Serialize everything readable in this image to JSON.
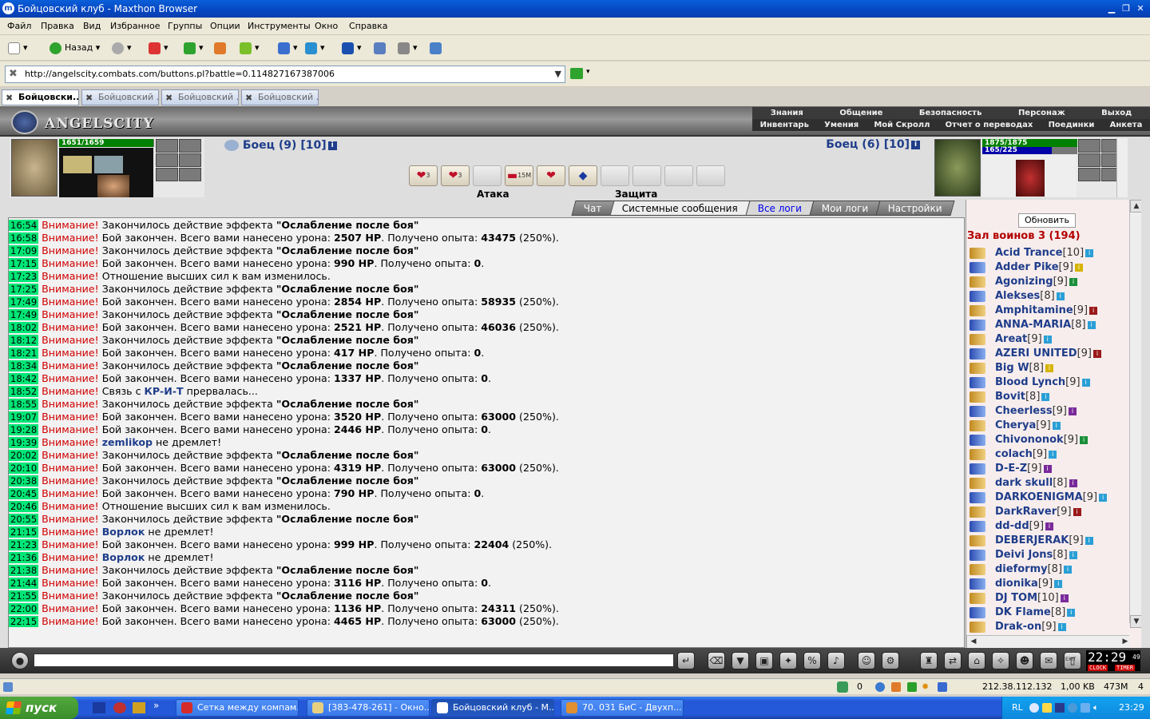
{
  "window": {
    "title": "Бойцовский клуб - Maxthon Browser"
  },
  "menu": [
    "Файл",
    "Правка",
    "Вид",
    "Избранное",
    "Группы",
    "Опции",
    "Инструменты",
    "Окно",
    "Справка"
  ],
  "toolbar": {
    "back_label": "Назад"
  },
  "address": {
    "url": "http://angelscity.combats.com/buttons.pl?battle=0.114827167387006"
  },
  "tabs": [
    {
      "label": "Бойцовски...",
      "active": true
    },
    {
      "label": "Бойцовский ...",
      "active": false
    },
    {
      "label": "Бойцовский ...",
      "active": false
    },
    {
      "label": "Бойцовский ...",
      "active": false
    }
  ],
  "game": {
    "logo": "ANGELSCITY",
    "menu_top": [
      "Знания",
      "Общение",
      "Безопасность",
      "Персонаж",
      "Выход"
    ],
    "menu_bottom": [
      "Инвентарь",
      "Умения",
      "Мой Скролл",
      "Отчет о переводах",
      "Поединки",
      "Анкета"
    ],
    "left_fighter": {
      "hp": "1651/1659",
      "hp_fraction": 0.995,
      "name": "Боец (9) [10]"
    },
    "right_fighter": {
      "hp": "1875/1875",
      "hp_fraction": 1.0,
      "mp": "165/225",
      "mp_fraction": 0.733,
      "name": "Боец (6) [10]"
    },
    "scrolls": [
      {
        "icon": "heart-icon",
        "empty": false,
        "badge": "3"
      },
      {
        "icon": "heart-icon",
        "empty": false,
        "badge": "3"
      },
      {
        "icon": "",
        "empty": true,
        "badge": ""
      },
      {
        "icon": "hat-icon",
        "empty": false,
        "badge": "15M"
      },
      {
        "icon": "heart-icon",
        "empty": false,
        "badge": ""
      },
      {
        "icon": "diamond-icon",
        "empty": false,
        "badge": ""
      },
      {
        "icon": "",
        "empty": true,
        "badge": ""
      },
      {
        "icon": "",
        "empty": true,
        "badge": ""
      },
      {
        "icon": "",
        "empty": true,
        "badge": ""
      },
      {
        "icon": "",
        "empty": true,
        "badge": ""
      }
    ],
    "attack_label": "Атака",
    "defense_label": "Защита",
    "chat_tabs": [
      {
        "label": "Чат",
        "style": "normal"
      },
      {
        "label": "Системные сообщения",
        "style": "sel"
      },
      {
        "label": "Все логи",
        "style": "hl"
      },
      {
        "label": "Мои логи",
        "style": "normal"
      },
      {
        "label": "Настройки",
        "style": "normal"
      }
    ],
    "warn_word": "Внимание!",
    "log": [
      {
        "t": "16:54",
        "p": [
          [
            "Закончилось действие эффекта ",
            ""
          ],
          [
            "\"Ослабление после боя\"",
            "b"
          ]
        ]
      },
      {
        "t": "16:58",
        "p": [
          [
            "Бой закончен. Всего вами нанесено урона: ",
            ""
          ],
          [
            "2507 HP",
            "b"
          ],
          [
            ". Получено опыта: ",
            ""
          ],
          [
            "43475",
            "b"
          ],
          [
            " (250%).",
            ""
          ]
        ]
      },
      {
        "t": "17:09",
        "p": [
          [
            "Закончилось действие эффекта ",
            ""
          ],
          [
            "\"Ослабление после боя\"",
            "b"
          ]
        ]
      },
      {
        "t": "17:15",
        "p": [
          [
            "Бой закончен. Всего вами нанесено урона: ",
            ""
          ],
          [
            "990 HP",
            "b"
          ],
          [
            ". Получено опыта: ",
            ""
          ],
          [
            "0",
            "b"
          ],
          [
            ".",
            ""
          ]
        ]
      },
      {
        "t": "17:23",
        "p": [
          [
            "Отношение высших сил к вам изменилось.",
            ""
          ]
        ]
      },
      {
        "t": "17:25",
        "p": [
          [
            "Закончилось действие эффекта ",
            ""
          ],
          [
            "\"Ослабление после боя\"",
            "b"
          ]
        ]
      },
      {
        "t": "17:49",
        "p": [
          [
            "Бой закончен. Всего вами нанесено урона: ",
            ""
          ],
          [
            "2854 HP",
            "b"
          ],
          [
            ". Получено опыта: ",
            ""
          ],
          [
            "58935",
            "b"
          ],
          [
            " (250%).",
            ""
          ]
        ]
      },
      {
        "t": "17:49",
        "p": [
          [
            "Закончилось действие эффекта ",
            ""
          ],
          [
            "\"Ослабление после боя\"",
            "b"
          ]
        ]
      },
      {
        "t": "18:02",
        "p": [
          [
            "Бой закончен. Всего вами нанесено урона: ",
            ""
          ],
          [
            "2521 HP",
            "b"
          ],
          [
            ". Получено опыта: ",
            ""
          ],
          [
            "46036",
            "b"
          ],
          [
            " (250%).",
            ""
          ]
        ]
      },
      {
        "t": "18:12",
        "p": [
          [
            "Закончилось действие эффекта ",
            ""
          ],
          [
            "\"Ослабление после боя\"",
            "b"
          ]
        ]
      },
      {
        "t": "18:21",
        "p": [
          [
            "Бой закончен. Всего вами нанесено урона: ",
            ""
          ],
          [
            "417 HP",
            "b"
          ],
          [
            ". Получено опыта: ",
            ""
          ],
          [
            "0",
            "b"
          ],
          [
            ".",
            ""
          ]
        ]
      },
      {
        "t": "18:34",
        "p": [
          [
            "Закончилось действие эффекта ",
            ""
          ],
          [
            "\"Ослабление после боя\"",
            "b"
          ]
        ]
      },
      {
        "t": "18:42",
        "p": [
          [
            "Бой закончен. Всего вами нанесено урона: ",
            ""
          ],
          [
            "1337 HP",
            "b"
          ],
          [
            ". Получено опыта: ",
            ""
          ],
          [
            "0",
            "b"
          ],
          [
            ".",
            ""
          ]
        ]
      },
      {
        "t": "18:52",
        "p": [
          [
            "Связь с ",
            ""
          ],
          [
            "КР-И-Т",
            "n"
          ],
          [
            " прервалась...",
            ""
          ]
        ]
      },
      {
        "t": "18:55",
        "p": [
          [
            "Закончилось действие эффекта ",
            ""
          ],
          [
            "\"Ослабление после боя\"",
            "b"
          ]
        ]
      },
      {
        "t": "19:07",
        "p": [
          [
            "Бой закончен. Всего вами нанесено урона: ",
            ""
          ],
          [
            "3520 HP",
            "b"
          ],
          [
            ". Получено опыта: ",
            ""
          ],
          [
            "63000",
            "b"
          ],
          [
            " (250%).",
            ""
          ]
        ]
      },
      {
        "t": "19:28",
        "p": [
          [
            "Бой закончен. Всего вами нанесено урона: ",
            ""
          ],
          [
            "2446 HP",
            "b"
          ],
          [
            ". Получено опыта: ",
            ""
          ],
          [
            "0",
            "b"
          ],
          [
            ".",
            ""
          ]
        ]
      },
      {
        "t": "19:39",
        "p": [
          [
            "zemlikop",
            "n"
          ],
          [
            " не дремлет!",
            ""
          ]
        ]
      },
      {
        "t": "20:02",
        "p": [
          [
            "Закончилось действие эффекта ",
            ""
          ],
          [
            "\"Ослабление после боя\"",
            "b"
          ]
        ]
      },
      {
        "t": "20:10",
        "p": [
          [
            "Бой закончен. Всего вами нанесено урона: ",
            ""
          ],
          [
            "4319 HP",
            "b"
          ],
          [
            ". Получено опыта: ",
            ""
          ],
          [
            "63000",
            "b"
          ],
          [
            " (250%).",
            ""
          ]
        ]
      },
      {
        "t": "20:38",
        "p": [
          [
            "Закончилось действие эффекта ",
            ""
          ],
          [
            "\"Ослабление после боя\"",
            "b"
          ]
        ]
      },
      {
        "t": "20:45",
        "p": [
          [
            "Бой закончен. Всего вами нанесено урона: ",
            ""
          ],
          [
            "790 HP",
            "b"
          ],
          [
            ". Получено опыта: ",
            ""
          ],
          [
            "0",
            "b"
          ],
          [
            ".",
            ""
          ]
        ]
      },
      {
        "t": "20:46",
        "p": [
          [
            "Отношение высших сил к вам изменилось.",
            ""
          ]
        ]
      },
      {
        "t": "20:55",
        "p": [
          [
            "Закончилось действие эффекта ",
            ""
          ],
          [
            "\"Ослабление после боя\"",
            "b"
          ]
        ]
      },
      {
        "t": "21:15",
        "p": [
          [
            "Ворлок",
            "n"
          ],
          [
            " не дремлет!",
            ""
          ]
        ]
      },
      {
        "t": "21:23",
        "p": [
          [
            "Бой закончен. Всего вами нанесено урона: ",
            ""
          ],
          [
            "999 HP",
            "b"
          ],
          [
            ". Получено опыта: ",
            ""
          ],
          [
            "22404",
            "b"
          ],
          [
            " (250%).",
            ""
          ]
        ]
      },
      {
        "t": "21:36",
        "p": [
          [
            "Ворлок",
            "n"
          ],
          [
            " не дремлет!",
            ""
          ]
        ]
      },
      {
        "t": "21:38",
        "p": [
          [
            "Закончилось действие эффекта ",
            ""
          ],
          [
            "\"Ослабление после боя\"",
            "b"
          ]
        ]
      },
      {
        "t": "21:44",
        "p": [
          [
            "Бой закончен. Всего вами нанесено урона: ",
            ""
          ],
          [
            "3116 HP",
            "b"
          ],
          [
            ". Получено опыта: ",
            ""
          ],
          [
            "0",
            "b"
          ],
          [
            ".",
            ""
          ]
        ]
      },
      {
        "t": "21:55",
        "p": [
          [
            "Закончилось действие эффекта ",
            ""
          ],
          [
            "\"Ослабление после боя\"",
            "b"
          ]
        ]
      },
      {
        "t": "22:00",
        "p": [
          [
            "Бой закончен. Всего вами нанесено урона: ",
            ""
          ],
          [
            "1136 HP",
            "b"
          ],
          [
            ". Получено опыта: ",
            ""
          ],
          [
            "24311",
            "b"
          ],
          [
            " (250%).",
            ""
          ]
        ]
      },
      {
        "t": "22:15",
        "p": [
          [
            "Бой закончен. Всего вами нанесено урона: ",
            ""
          ],
          [
            "4465 HP",
            "b"
          ],
          [
            ". Получено опыта: ",
            ""
          ],
          [
            "63000",
            "b"
          ],
          [
            " (250%).",
            ""
          ]
        ]
      }
    ],
    "sidebar": {
      "refresh_label": "Обновить",
      "room_title": "Зал воинов 3 (194)",
      "players": [
        {
          "name": "Acid Trance",
          "level": "[10]",
          "info": "#2a9fd6"
        },
        {
          "name": "Adder Pike",
          "level": "[9]",
          "info": "#d6b400"
        },
        {
          "name": "Agonizing",
          "level": "[9]",
          "info": "#1a8f3a"
        },
        {
          "name": "Alekses",
          "level": "[8]",
          "info": "#2a9fd6"
        },
        {
          "name": "Amphitamine",
          "level": "[9]",
          "info": "#9a1a1a"
        },
        {
          "name": "ANNA-MARIA",
          "level": "[8]",
          "info": "#2a9fd6"
        },
        {
          "name": "Areat",
          "level": "[9]",
          "info": "#2a9fd6"
        },
        {
          "name": "AZERI UNITED",
          "level": "[9]",
          "info": "#9a1a1a"
        },
        {
          "name": "Big W",
          "level": "[8]",
          "info": "#d6b400"
        },
        {
          "name": "Blood Lynch",
          "level": "[9]",
          "info": "#2a9fd6"
        },
        {
          "name": "Bovit",
          "level": "[8]",
          "info": "#2a9fd6"
        },
        {
          "name": "Cheerless",
          "level": "[9]",
          "info": "#7a2a9a"
        },
        {
          "name": "Cherya",
          "level": "[9]",
          "info": "#2a9fd6"
        },
        {
          "name": "Chivononok",
          "level": "[9]",
          "info": "#1a8f3a"
        },
        {
          "name": "colach",
          "level": "[9]",
          "info": "#2a9fd6"
        },
        {
          "name": "D-E-Z",
          "level": "[9]",
          "info": "#7a2a9a"
        },
        {
          "name": "dark skull",
          "level": "[8]",
          "info": "#7a2a9a"
        },
        {
          "name": "DARKOENIGMA",
          "level": "[9]",
          "info": "#2a9fd6"
        },
        {
          "name": "DarkRaver",
          "level": "[9]",
          "info": "#9a1a1a"
        },
        {
          "name": "dd-dd",
          "level": "[9]",
          "info": "#7a2a9a"
        },
        {
          "name": "DEBERJERAK",
          "level": "[9]",
          "info": "#2a9fd6"
        },
        {
          "name": "Deivi Jons",
          "level": "[8]",
          "info": "#2a9fd6"
        },
        {
          "name": "dieformy",
          "level": "[8]",
          "info": "#2a9fd6"
        },
        {
          "name": "dionika",
          "level": "[9]",
          "info": "#2a9fd6"
        },
        {
          "name": "DJ TOM",
          "level": "[10]",
          "info": "#7a2a9a"
        },
        {
          "name": "DK Flame",
          "level": "[8]",
          "info": "#2a9fd6"
        },
        {
          "name": "Drak-on",
          "level": "[9]",
          "info": "#2a9fd6"
        }
      ]
    },
    "clock": {
      "time": "22:29",
      "seconds": "49",
      "clock_label": "CLOCK",
      "timer_label": "TIMER",
      "exit_label": "EXIT"
    }
  },
  "statusbar": {
    "count": "0",
    "ip": "212.38.112.132",
    "speed": "1,00 KB",
    "memory": "473M",
    "num": "4"
  },
  "taskbar": {
    "start": "пуск",
    "tasks": [
      {
        "label": "Сетка между компам...",
        "active": false,
        "color": "#d62b2b"
      },
      {
        "label": "[383-478-261] - Окно...",
        "active": false,
        "color": "#e6d080"
      },
      {
        "label": "Бойцовский клуб - M...",
        "active": true,
        "color": "#ffffff"
      },
      {
        "label": "70. 031 БиС - Двухп...",
        "active": false,
        "color": "#e09030"
      }
    ],
    "lang": "RL",
    "time": "23:29"
  }
}
